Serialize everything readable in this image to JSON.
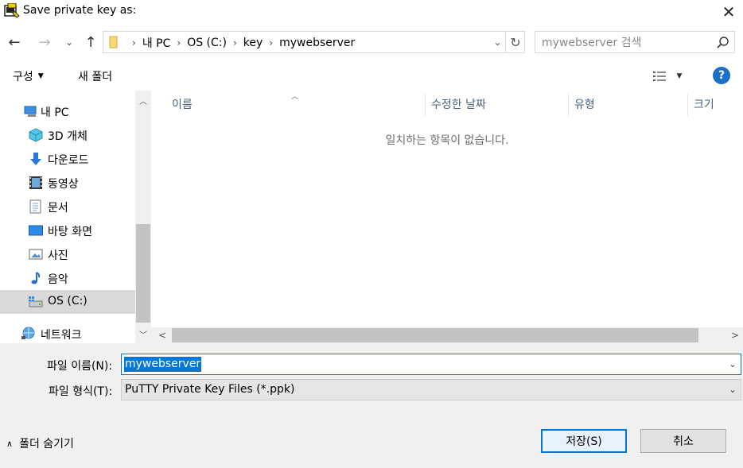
{
  "window": {
    "title": "Save private key as:",
    "close_glyph": "✕"
  },
  "navigation": {
    "back_glyph": "←",
    "forward_glyph": "→",
    "recent_glyph": "⌄",
    "up_glyph": "↑"
  },
  "address": {
    "crumbs": [
      "내 PC",
      "OS (C:)",
      "key",
      "mywebserver"
    ],
    "separator": "›",
    "dropdown_glyph": "⌄",
    "refresh_glyph": "↻"
  },
  "search": {
    "placeholder": "mywebserver 검색"
  },
  "toolbar": {
    "organize_label": "구성",
    "organize_arrow": "▼",
    "new_folder_label": "새 폴더",
    "view_dropdown_glyph": "▼",
    "help_label": "?"
  },
  "nav_pane": {
    "items": [
      {
        "label": "내 PC",
        "icon": "computer-icon"
      },
      {
        "label": "3D 개체",
        "icon": "cube-icon"
      },
      {
        "label": "다운로드",
        "icon": "download-icon"
      },
      {
        "label": "동영상",
        "icon": "video-icon"
      },
      {
        "label": "문서",
        "icon": "document-icon"
      },
      {
        "label": "바탕 화면",
        "icon": "desktop-icon"
      },
      {
        "label": "사진",
        "icon": "picture-icon"
      },
      {
        "label": "음악",
        "icon": "music-icon"
      },
      {
        "label": "OS (C:)",
        "icon": "drive-icon",
        "selected": true
      },
      {
        "label": "네트워크",
        "icon": "network-icon"
      }
    ],
    "scroll_up_glyph": "︿",
    "scroll_down_glyph": "﹀"
  },
  "file_list": {
    "columns": [
      "이름",
      "수정한 날짜",
      "유형",
      "크기"
    ],
    "sort_glyph": "︿",
    "empty_message": "일치하는 항목이 없습니다.",
    "scroll_left_glyph": "<",
    "scroll_right_glyph": ">"
  },
  "form": {
    "filename_label": "파일 이름(N):",
    "filename_value": "mywebserver",
    "filetype_label": "파일 형식(T):",
    "filetype_value": "PuTTY Private Key Files (*.ppk)",
    "dropdown_glyph": "⌄"
  },
  "footer": {
    "hide_folders_glyph": "∧",
    "hide_folders_label": "폴더 숨기기",
    "save_label": "저장(S)",
    "cancel_label": "취소"
  },
  "colors": {
    "accent": "#0078d7",
    "help": "#1a6fc9",
    "selected_nav": "#d9d9d9",
    "column_header_text": "#4c607a"
  }
}
